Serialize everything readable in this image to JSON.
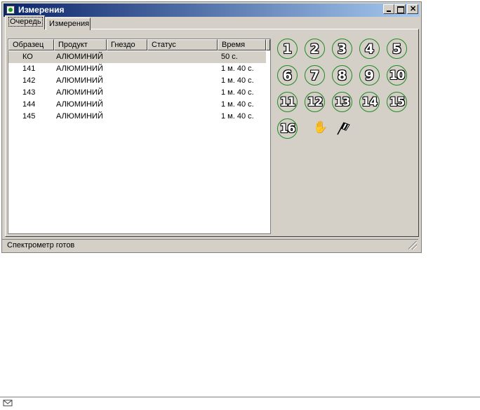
{
  "window": {
    "title": "Измерения"
  },
  "tabs": [
    {
      "label": "Очередь",
      "active": true
    },
    {
      "label": "Измерения",
      "active": false
    }
  ],
  "table": {
    "columns": [
      "Образец",
      "Продукт",
      "Гнездо",
      "Статус",
      "Время"
    ],
    "rows": [
      {
        "sample": "КО",
        "product": "АЛЮМИНИЙ",
        "slot": "",
        "status": "",
        "time": "50 с."
      },
      {
        "sample": "141",
        "product": "АЛЮМИНИЙ",
        "slot": "",
        "status": "",
        "time": "1 м. 40 с."
      },
      {
        "sample": "142",
        "product": "АЛЮМИНИЙ",
        "slot": "",
        "status": "",
        "time": "1 м. 40 с."
      },
      {
        "sample": "143",
        "product": "АЛЮМИНИЙ",
        "slot": "",
        "status": "",
        "time": "1 м. 40 с."
      },
      {
        "sample": "144",
        "product": "АЛЮМИНИЙ",
        "slot": "",
        "status": "",
        "time": "1 м. 40 с."
      },
      {
        "sample": "145",
        "product": "АЛЮМИНИЙ",
        "slot": "",
        "status": "",
        "time": "1 м. 40 с."
      }
    ]
  },
  "sampler": {
    "positions": [
      "1",
      "2",
      "3",
      "4",
      "5",
      "6",
      "7",
      "8",
      "9",
      "10",
      "11",
      "12",
      "13",
      "14",
      "15",
      "16"
    ],
    "ring_color": "#1f8a1f",
    "tools": [
      "hand-icon",
      "checkered-flag-icon"
    ]
  },
  "status": {
    "text": "Спектрометр готов"
  }
}
